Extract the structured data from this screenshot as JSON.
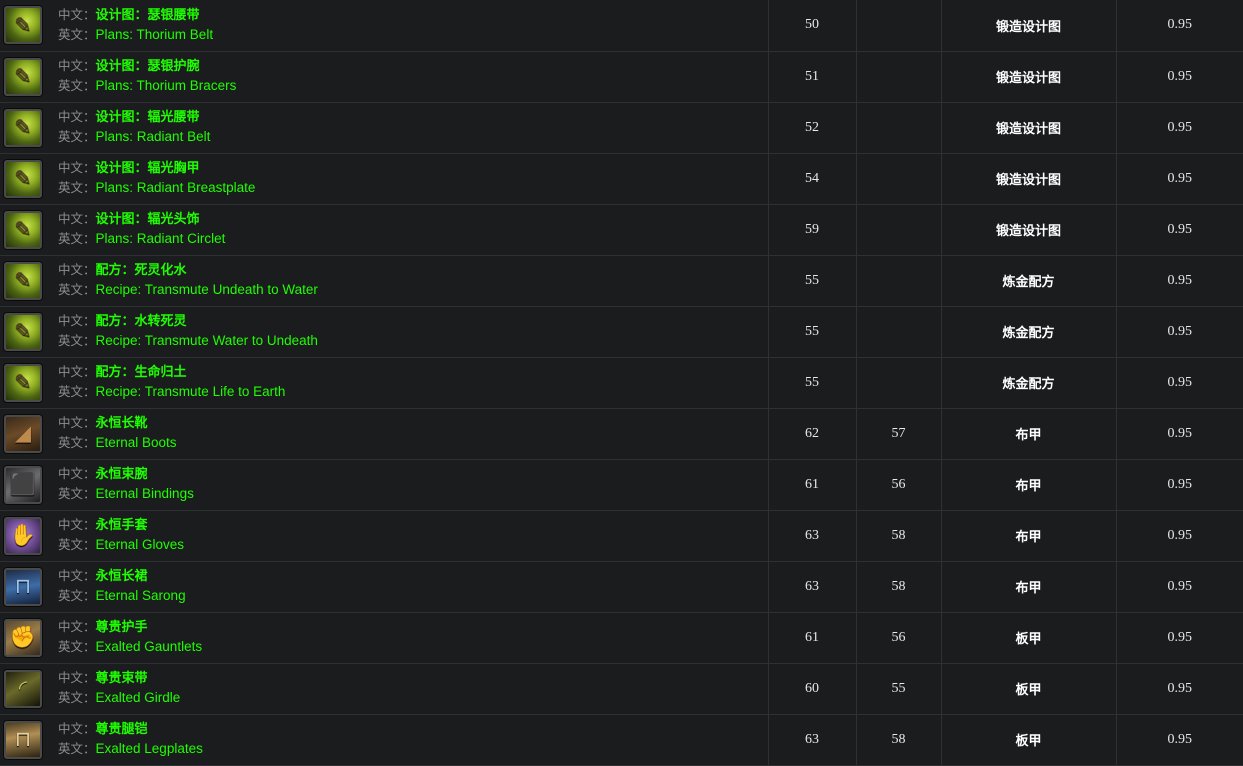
{
  "table": {
    "labels": {
      "cn_prefix": "中文：",
      "en_prefix": "英文："
    },
    "colors": {
      "item_name": "#1eff00",
      "label": "#8d8d8d",
      "row_bg": "#1b1c1e",
      "grid": "#2e3033",
      "value_text": "#e8e8e8"
    },
    "rows": [
      {
        "icon": "plans-scroll-icon",
        "icon_class": "ic-plans",
        "glyph": "✎",
        "name_cn": "设计图：瑟银腰带",
        "name_en": "Plans: Thorium Belt",
        "item_level": "50",
        "required_level": "",
        "category": "锻造设计图",
        "value": "0.95"
      },
      {
        "icon": "plans-scroll-icon",
        "icon_class": "ic-plans",
        "glyph": "✎",
        "name_cn": "设计图：瑟银护腕",
        "name_en": "Plans: Thorium Bracers",
        "item_level": "51",
        "required_level": "",
        "category": "锻造设计图",
        "value": "0.95"
      },
      {
        "icon": "plans-scroll-icon",
        "icon_class": "ic-plans",
        "glyph": "✎",
        "name_cn": "设计图：辐光腰带",
        "name_en": "Plans: Radiant Belt",
        "item_level": "52",
        "required_level": "",
        "category": "锻造设计图",
        "value": "0.95"
      },
      {
        "icon": "plans-scroll-icon",
        "icon_class": "ic-plans",
        "glyph": "✎",
        "name_cn": "设计图：辐光胸甲",
        "name_en": "Plans: Radiant Breastplate",
        "item_level": "54",
        "required_level": "",
        "category": "锻造设计图",
        "value": "0.95"
      },
      {
        "icon": "plans-scroll-icon",
        "icon_class": "ic-plans",
        "glyph": "✎",
        "name_cn": "设计图：辐光头饰",
        "name_en": "Plans: Radiant Circlet",
        "item_level": "59",
        "required_level": "",
        "category": "锻造设计图",
        "value": "0.95"
      },
      {
        "icon": "recipe-scroll-icon",
        "icon_class": "ic-plans",
        "glyph": "✎",
        "name_cn": "配方：死灵化水",
        "name_en": "Recipe: Transmute Undeath to Water",
        "item_level": "55",
        "required_level": "",
        "category": "炼金配方",
        "value": "0.95"
      },
      {
        "icon": "recipe-scroll-icon",
        "icon_class": "ic-plans",
        "glyph": "✎",
        "name_cn": "配方：水转死灵",
        "name_en": "Recipe: Transmute Water to Undeath",
        "item_level": "55",
        "required_level": "",
        "category": "炼金配方",
        "value": "0.95"
      },
      {
        "icon": "recipe-scroll-icon",
        "icon_class": "ic-plans",
        "glyph": "✎",
        "name_cn": "配方：生命归土",
        "name_en": "Recipe: Transmute Life to Earth",
        "item_level": "55",
        "required_level": "",
        "category": "炼金配方",
        "value": "0.95"
      },
      {
        "icon": "boots-icon",
        "icon_class": "ic-boots",
        "glyph": "◢",
        "name_cn": "永恒长靴",
        "name_en": "Eternal Boots",
        "item_level": "62",
        "required_level": "57",
        "category": "布甲",
        "value": "0.95"
      },
      {
        "icon": "bracers-icon",
        "icon_class": "ic-bindings",
        "glyph": "⬛",
        "name_cn": "永恒束腕",
        "name_en": "Eternal Bindings",
        "item_level": "61",
        "required_level": "56",
        "category": "布甲",
        "value": "0.95"
      },
      {
        "icon": "gloves-icon",
        "icon_class": "ic-gloves",
        "glyph": "✋",
        "name_cn": "永恒手套",
        "name_en": "Eternal Gloves",
        "item_level": "63",
        "required_level": "58",
        "category": "布甲",
        "value": "0.95"
      },
      {
        "icon": "legs-icon",
        "icon_class": "ic-sarong",
        "glyph": "⊓",
        "name_cn": "永恒长裙",
        "name_en": "Eternal Sarong",
        "item_level": "63",
        "required_level": "58",
        "category": "布甲",
        "value": "0.95"
      },
      {
        "icon": "gauntlets-icon",
        "icon_class": "ic-gauntlets",
        "glyph": "✊",
        "name_cn": "尊贵护手",
        "name_en": "Exalted Gauntlets",
        "item_level": "61",
        "required_level": "56",
        "category": "板甲",
        "value": "0.95"
      },
      {
        "icon": "belt-icon",
        "icon_class": "ic-girdle",
        "glyph": "◜",
        "name_cn": "尊贵束带",
        "name_en": "Exalted Girdle",
        "item_level": "60",
        "required_level": "55",
        "category": "板甲",
        "value": "0.95"
      },
      {
        "icon": "legplates-icon",
        "icon_class": "ic-legplates",
        "glyph": "⊓",
        "name_cn": "尊贵腿铠",
        "name_en": "Exalted Legplates",
        "item_level": "63",
        "required_level": "58",
        "category": "板甲",
        "value": "0.95"
      }
    ]
  }
}
